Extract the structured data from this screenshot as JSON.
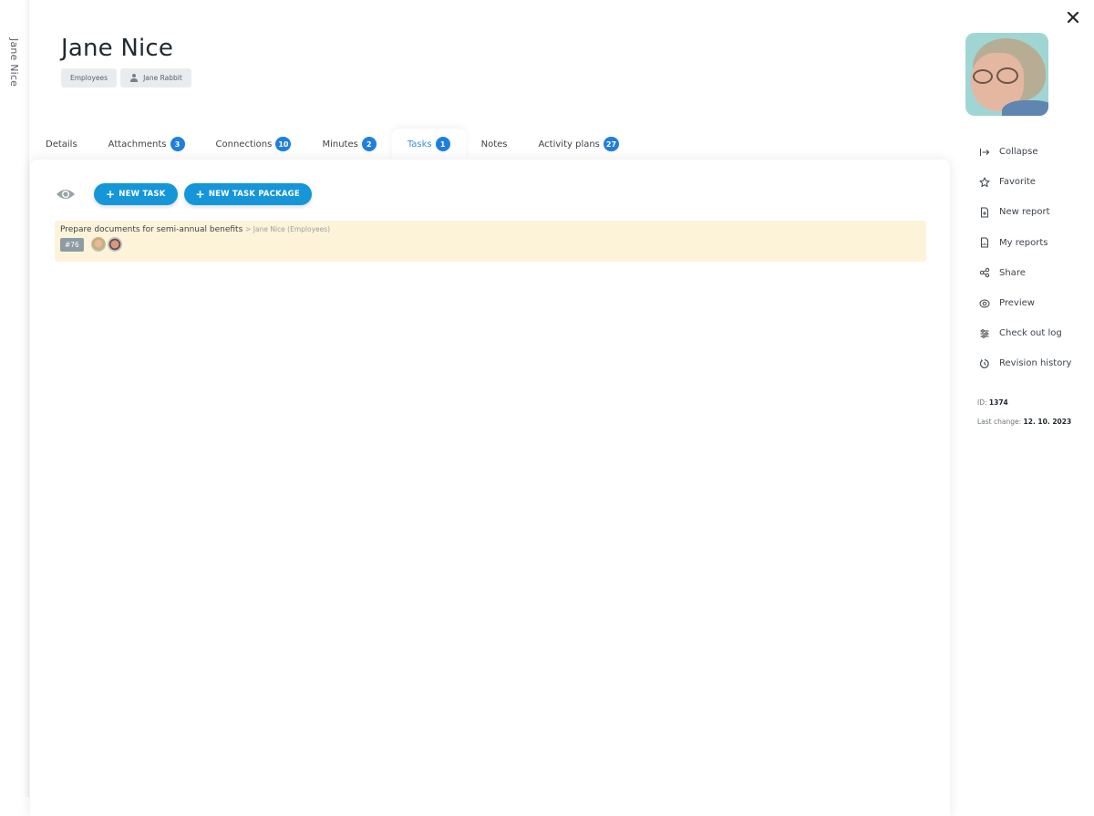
{
  "left_strip": {
    "label": "Jane Nice"
  },
  "header": {
    "title": "Jane Nice",
    "chips": [
      {
        "label": "Employees",
        "icon": null
      },
      {
        "label": "Jane Rabbit",
        "icon": "person-icon"
      }
    ]
  },
  "tabs": [
    {
      "label": "Details",
      "badge": null,
      "active": false
    },
    {
      "label": "Attachments",
      "badge": "3",
      "active": false
    },
    {
      "label": "Connections",
      "badge": "10",
      "active": false
    },
    {
      "label": "Minutes",
      "badge": "2",
      "active": false
    },
    {
      "label": "Tasks",
      "badge": "1",
      "active": true
    },
    {
      "label": "Notes",
      "badge": null,
      "active": false
    },
    {
      "label": "Activity plans",
      "badge": "27",
      "active": false
    }
  ],
  "toolbar": {
    "visibility_icon": "eye-icon",
    "new_task_label": "NEW TASK",
    "new_task_package_label": "NEW TASK PACKAGE",
    "plus": "+"
  },
  "tasks": [
    {
      "title": "Prepare documents for semi-annual benefits",
      "path": "> Jane Nice (Employees)",
      "number": "#76",
      "assignees": 2
    }
  ],
  "side_menu": [
    {
      "label": "Collapse",
      "icon": "collapse-icon"
    },
    {
      "label": "Favorite",
      "icon": "star-icon"
    },
    {
      "label": "New report",
      "icon": "new-report-icon"
    },
    {
      "label": "My reports",
      "icon": "reports-icon"
    },
    {
      "label": "Share",
      "icon": "share-icon"
    },
    {
      "label": "Preview",
      "icon": "preview-icon"
    },
    {
      "label": "Check out log",
      "icon": "checkout-log-icon"
    },
    {
      "label": "Revision history",
      "icon": "history-icon"
    }
  ],
  "meta": {
    "id_label": "ID:",
    "id_value": "1374",
    "last_change_label": "Last change:",
    "last_change_value": "12. 10. 2023"
  },
  "colors": {
    "accent": "#1596d9",
    "badge": "#1f7fe0",
    "active_tab": "#3a8fde",
    "task_bg": "#fcf3d9",
    "tag_bg": "#8d9ba2"
  }
}
